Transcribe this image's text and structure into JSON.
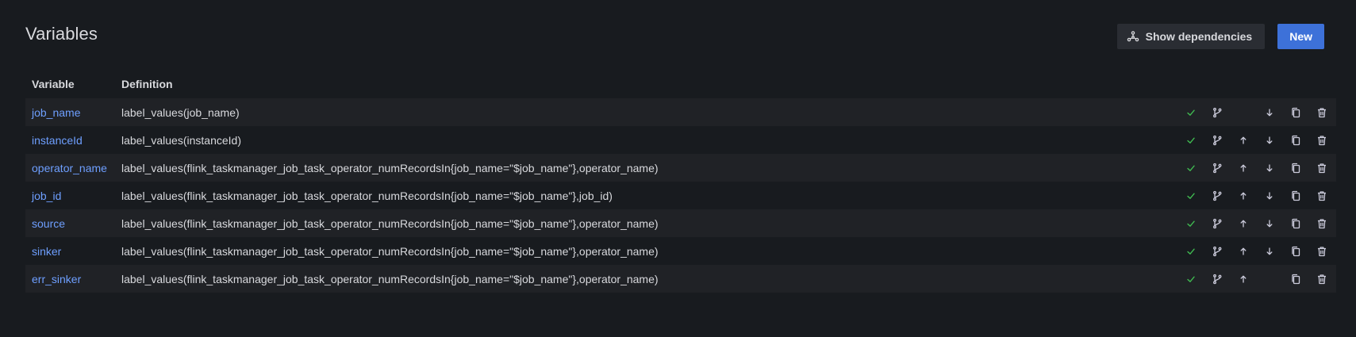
{
  "page": {
    "title": "Variables"
  },
  "header": {
    "show_dependencies_label": "Show dependencies",
    "new_label": "New"
  },
  "table": {
    "columns": [
      "Variable",
      "Definition"
    ],
    "rows": [
      {
        "name": "job_name",
        "definition": "label_values(job_name)",
        "move_up": false,
        "move_down": true
      },
      {
        "name": "instanceId",
        "definition": "label_values(instanceId)",
        "move_up": true,
        "move_down": true
      },
      {
        "name": "operator_name",
        "definition": "label_values(flink_taskmanager_job_task_operator_numRecordsIn{job_name=\"$job_name\"},operator_name)",
        "move_up": true,
        "move_down": true
      },
      {
        "name": "job_id",
        "definition": "label_values(flink_taskmanager_job_task_operator_numRecordsIn{job_name=\"$job_name\"},job_id)",
        "move_up": true,
        "move_down": true
      },
      {
        "name": "source",
        "definition": "label_values(flink_taskmanager_job_task_operator_numRecordsIn{job_name=\"$job_name\"},operator_name)",
        "move_up": true,
        "move_down": true
      },
      {
        "name": "sinker",
        "definition": "label_values(flink_taskmanager_job_task_operator_numRecordsIn{job_name=\"$job_name\"},operator_name)",
        "move_up": true,
        "move_down": true
      },
      {
        "name": "err_sinker",
        "definition": "label_values(flink_taskmanager_job_task_operator_numRecordsIn{job_name=\"$job_name\"},operator_name)",
        "move_up": true,
        "move_down": false
      }
    ]
  },
  "icons": {
    "check": "check-icon",
    "branch": "code-branch-icon",
    "up": "arrow-up-icon",
    "down": "arrow-down-icon",
    "duplicate": "copy-icon",
    "delete": "trash-icon"
  },
  "colors": {
    "background": "#181b1f",
    "row_alt": "#202226",
    "link": "#6e9fff",
    "primary": "#3d71d9",
    "check": "#3fb950"
  }
}
